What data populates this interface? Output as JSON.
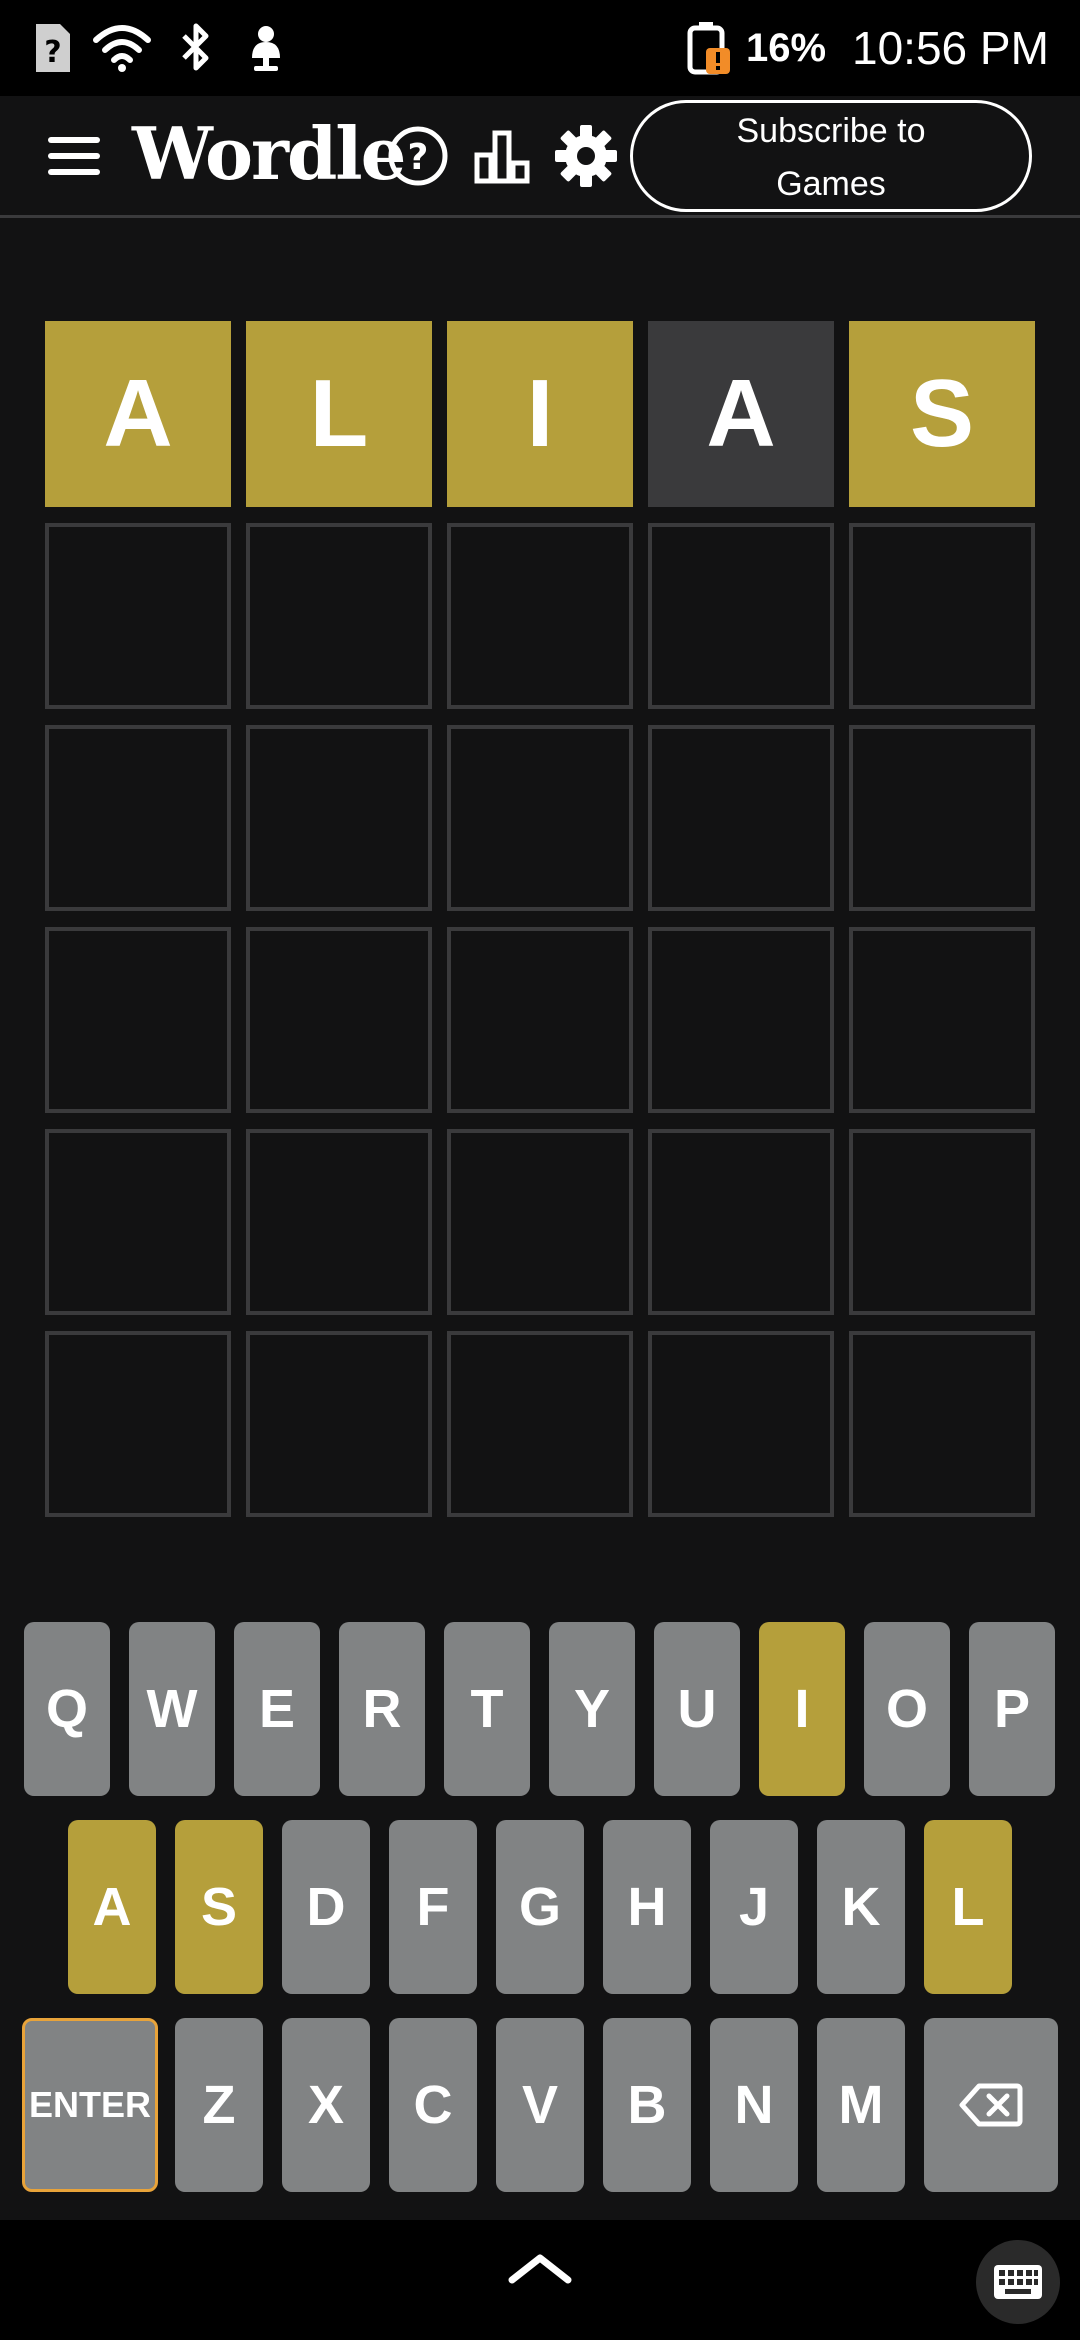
{
  "status_bar": {
    "battery_percent": "16%",
    "time": "10:56 PM",
    "icons": [
      "sim-unknown-icon",
      "wifi-icon",
      "bluetooth-icon",
      "notification-person-icon",
      "battery-alert-icon"
    ]
  },
  "header": {
    "title": "Wordle",
    "subscribe_label": "Subscribe to Games",
    "subscribe_line1": "Subscribe to",
    "subscribe_line2": "Games",
    "icons": [
      "menu-icon",
      "help-icon",
      "stats-icon",
      "settings-icon"
    ]
  },
  "colors": {
    "background": "#121213",
    "present": "#b59f3b",
    "absent": "#3a3a3c",
    "key": "#818384",
    "empty_border": "#3a3a3c",
    "enter_outline": "#e8a33a"
  },
  "board": {
    "rows": [
      [
        {
          "letter": "A",
          "state": "present"
        },
        {
          "letter": "L",
          "state": "present"
        },
        {
          "letter": "I",
          "state": "present"
        },
        {
          "letter": "A",
          "state": "absent"
        },
        {
          "letter": "S",
          "state": "present"
        }
      ],
      [
        {
          "letter": "",
          "state": "empty"
        },
        {
          "letter": "",
          "state": "empty"
        },
        {
          "letter": "",
          "state": "empty"
        },
        {
          "letter": "",
          "state": "empty"
        },
        {
          "letter": "",
          "state": "empty"
        }
      ],
      [
        {
          "letter": "",
          "state": "empty"
        },
        {
          "letter": "",
          "state": "empty"
        },
        {
          "letter": "",
          "state": "empty"
        },
        {
          "letter": "",
          "state": "empty"
        },
        {
          "letter": "",
          "state": "empty"
        }
      ],
      [
        {
          "letter": "",
          "state": "empty"
        },
        {
          "letter": "",
          "state": "empty"
        },
        {
          "letter": "",
          "state": "empty"
        },
        {
          "letter": "",
          "state": "empty"
        },
        {
          "letter": "",
          "state": "empty"
        }
      ],
      [
        {
          "letter": "",
          "state": "empty"
        },
        {
          "letter": "",
          "state": "empty"
        },
        {
          "letter": "",
          "state": "empty"
        },
        {
          "letter": "",
          "state": "empty"
        },
        {
          "letter": "",
          "state": "empty"
        }
      ],
      [
        {
          "letter": "",
          "state": "empty"
        },
        {
          "letter": "",
          "state": "empty"
        },
        {
          "letter": "",
          "state": "empty"
        },
        {
          "letter": "",
          "state": "empty"
        },
        {
          "letter": "",
          "state": "empty"
        }
      ]
    ]
  },
  "keyboard": {
    "rows": [
      [
        {
          "key": "Q"
        },
        {
          "key": "W"
        },
        {
          "key": "E"
        },
        {
          "key": "R"
        },
        {
          "key": "T"
        },
        {
          "key": "Y"
        },
        {
          "key": "U"
        },
        {
          "key": "I",
          "state": "present"
        },
        {
          "key": "O"
        },
        {
          "key": "P"
        }
      ],
      [
        {
          "key": "A",
          "state": "present"
        },
        {
          "key": "S",
          "state": "present"
        },
        {
          "key": "D"
        },
        {
          "key": "F"
        },
        {
          "key": "G"
        },
        {
          "key": "H"
        },
        {
          "key": "J"
        },
        {
          "key": "K"
        },
        {
          "key": "L",
          "state": "present"
        }
      ],
      [
        {
          "key": "ENTER",
          "type": "enter"
        },
        {
          "key": "Z"
        },
        {
          "key": "X"
        },
        {
          "key": "C"
        },
        {
          "key": "V"
        },
        {
          "key": "B"
        },
        {
          "key": "N"
        },
        {
          "key": "M"
        },
        {
          "key": "",
          "type": "backspace",
          "icon": "backspace-icon"
        }
      ]
    ]
  },
  "nav_bar": {
    "icons": [
      "chevron-up-icon",
      "keyboard-icon"
    ]
  }
}
